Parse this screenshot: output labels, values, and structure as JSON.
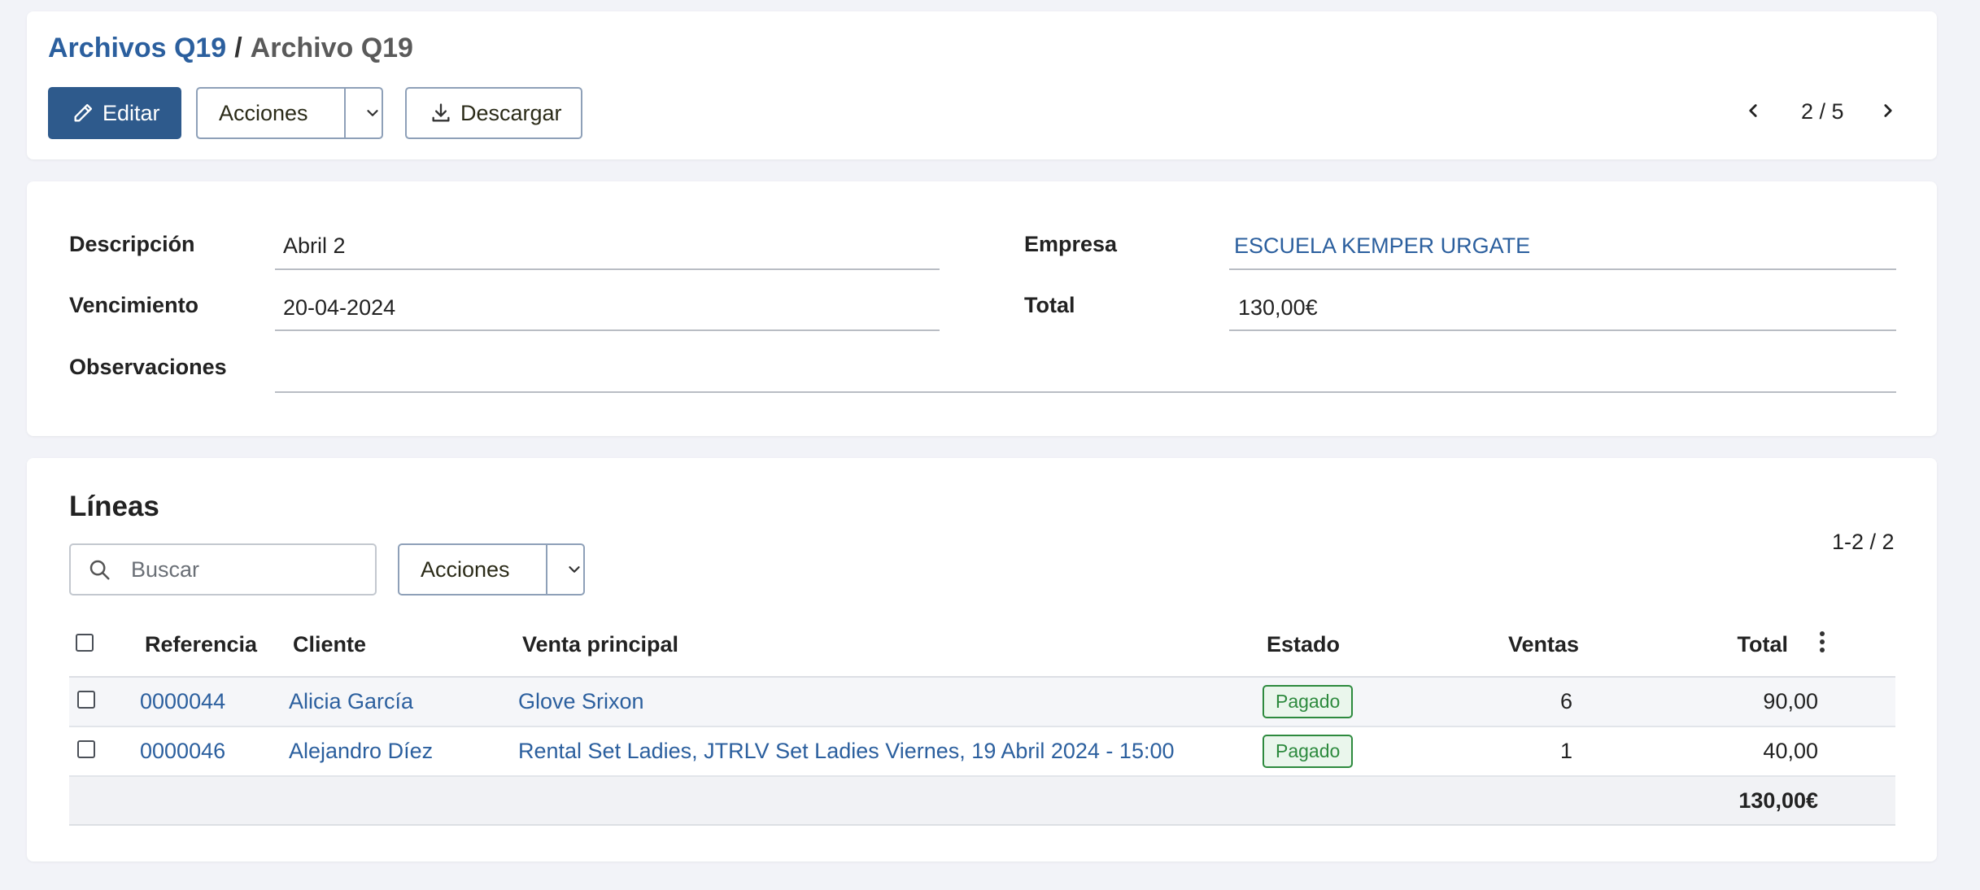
{
  "header": {
    "breadcrumb_parent": "Archivos Q19",
    "breadcrumb_separator": "/",
    "breadcrumb_current": "Archivo Q19",
    "edit_label": "Editar",
    "actions_label": "Acciones",
    "download_label": "Descargar",
    "pager_text": "2 / 5"
  },
  "form": {
    "description_label": "Descripción",
    "description_value": "Abril 2",
    "due_label": "Vencimiento",
    "due_value": "20-04-2024",
    "notes_label": "Observaciones",
    "notes_value": "",
    "company_label": "Empresa",
    "company_value": "ESCUELA KEMPER URGATE",
    "total_label": "Total",
    "total_value": "130,00€"
  },
  "lines": {
    "title": "Líneas",
    "search_placeholder": "Buscar",
    "actions_label": "Acciones",
    "range_text": "1-2 / 2",
    "columns": [
      "Referencia",
      "Cliente",
      "Venta principal",
      "Estado",
      "Ventas",
      "Total"
    ],
    "rows": [
      {
        "ref": "0000044",
        "client": "Alicia García",
        "sale": "Glove Srixon",
        "status": "Pagado",
        "sales": "6",
        "total": "90,00"
      },
      {
        "ref": "0000046",
        "client": "Alejandro Díez",
        "sale": "Rental Set Ladies, JTRLV Set Ladies Viernes, 19 Abril 2024 - 15:00",
        "status": "Pagado",
        "sales": "1",
        "total": "40,00"
      }
    ],
    "footer_total": "130,00€"
  },
  "colors": {
    "primary": "#2e5a8c",
    "link": "#2b5f9e",
    "status_paid": "#2d8a3e",
    "background": "#f2f3f8"
  },
  "icons": [
    "pencil-icon",
    "chevron-down-icon",
    "download-icon",
    "chevron-left-icon",
    "chevron-right-icon",
    "search-icon",
    "kebab-menu-icon"
  ]
}
